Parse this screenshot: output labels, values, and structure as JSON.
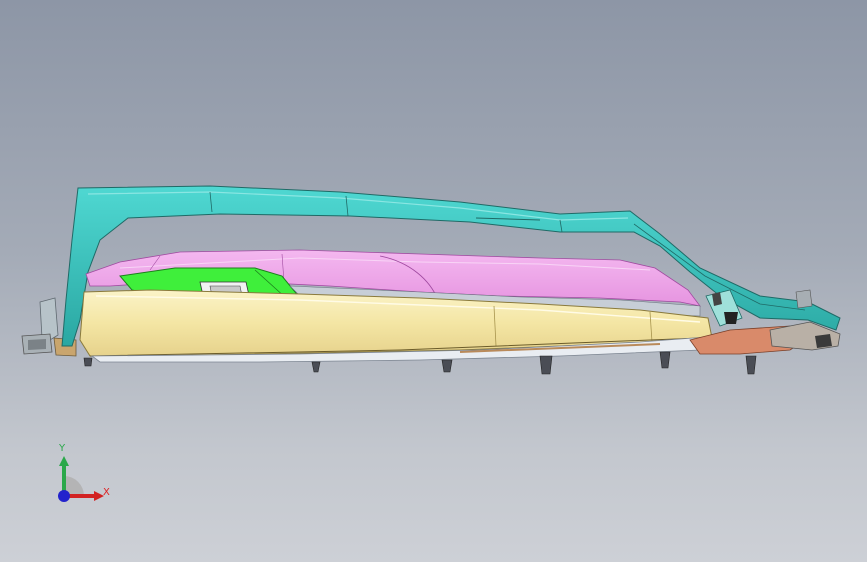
{
  "viewport": {
    "background_top": "#8d96a6",
    "background_bottom": "#cdd0d6"
  },
  "model": {
    "parts": [
      {
        "name": "outer-frame",
        "color": "#3fc6c0"
      },
      {
        "name": "upper-panel",
        "color": "#ee9ee8"
      },
      {
        "name": "insert-panel",
        "color": "#3ef03a"
      },
      {
        "name": "main-body",
        "color": "#f4e8a8"
      },
      {
        "name": "bracket",
        "color": "#d98a6a"
      },
      {
        "name": "clips",
        "color": "#4a4d55"
      }
    ]
  },
  "triad": {
    "y_label": "Y",
    "x_label": "X",
    "y_color": "#2aa84a",
    "x_color": "#d22222",
    "z_color": "#2222cc"
  }
}
